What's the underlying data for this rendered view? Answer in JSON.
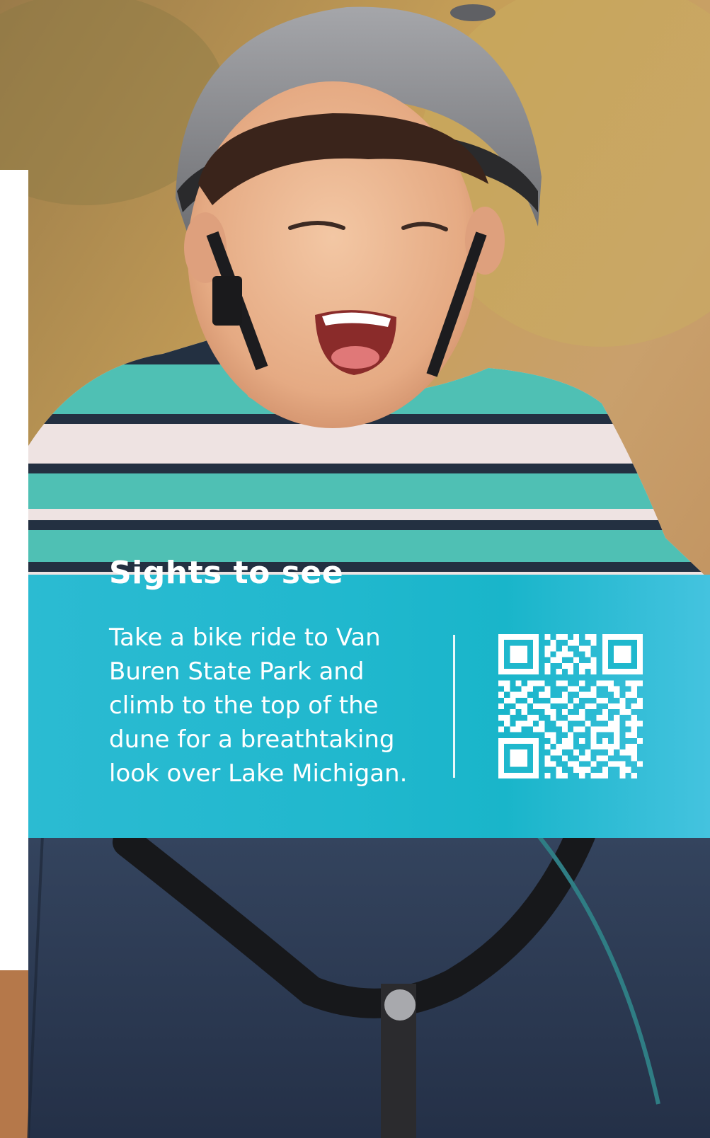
{
  "panel": {
    "title": "Sights to see",
    "body": "Take a bike ride to Van Buren State Park and climb to the top of the dune for a breathtaking look over Lake Michigan."
  },
  "colors": {
    "band": "#1fb8cd",
    "text": "#ffffff",
    "shirt_teal": "#4fc0b4",
    "shirt_white": "#f1e7e7",
    "helmet": "#8b8c90"
  },
  "photo": {
    "subject": "laughing boy in bike helmet and striped shirt riding a bicycle"
  },
  "qr": {
    "icon": "qr-code-icon"
  }
}
